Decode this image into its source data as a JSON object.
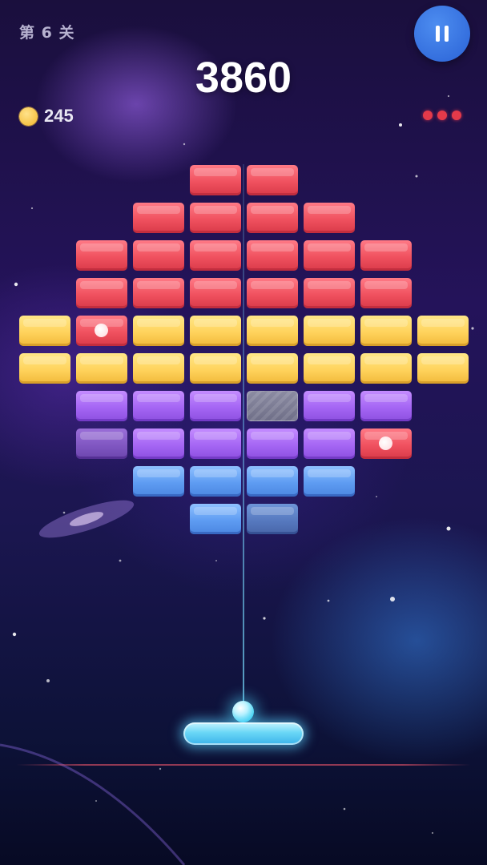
{
  "hud": {
    "level_label": "第 6 关",
    "score": "3860",
    "coins": "245",
    "lives": 3
  },
  "icons": {
    "pause": "pause-icon",
    "coin": "coin-icon",
    "life": "heart-dot-icon"
  },
  "colors": {
    "red": "#f0515f",
    "yellow": "#ffd35c",
    "purple": "#a566f4",
    "blue": "#5e9cf2",
    "steel": "#7a7a92",
    "paddle": "#6ad7f6",
    "pause_button": "#2f6fe0"
  },
  "bricks": [
    {
      "row": 0,
      "col": 3,
      "type": "red"
    },
    {
      "row": 0,
      "col": 4,
      "type": "red"
    },
    {
      "row": 1,
      "col": 2,
      "type": "red"
    },
    {
      "row": 1,
      "col": 3,
      "type": "red"
    },
    {
      "row": 1,
      "col": 4,
      "type": "red"
    },
    {
      "row": 1,
      "col": 5,
      "type": "red"
    },
    {
      "row": 2,
      "col": 1,
      "type": "red"
    },
    {
      "row": 2,
      "col": 2,
      "type": "red"
    },
    {
      "row": 2,
      "col": 3,
      "type": "red"
    },
    {
      "row": 2,
      "col": 4,
      "type": "red"
    },
    {
      "row": 2,
      "col": 5,
      "type": "red"
    },
    {
      "row": 2,
      "col": 6,
      "type": "red"
    },
    {
      "row": 3,
      "col": 1,
      "type": "red"
    },
    {
      "row": 3,
      "col": 2,
      "type": "red"
    },
    {
      "row": 3,
      "col": 3,
      "type": "red"
    },
    {
      "row": 3,
      "col": 4,
      "type": "red"
    },
    {
      "row": 3,
      "col": 5,
      "type": "red"
    },
    {
      "row": 3,
      "col": 6,
      "type": "red"
    },
    {
      "row": 4,
      "col": 0,
      "type": "yellow"
    },
    {
      "row": 4,
      "col": 1,
      "type": "red",
      "powerup": true
    },
    {
      "row": 4,
      "col": 2,
      "type": "yellow"
    },
    {
      "row": 4,
      "col": 3,
      "type": "yellow"
    },
    {
      "row": 4,
      "col": 4,
      "type": "yellow"
    },
    {
      "row": 4,
      "col": 5,
      "type": "yellow"
    },
    {
      "row": 4,
      "col": 6,
      "type": "yellow"
    },
    {
      "row": 4,
      "col": 7,
      "type": "yellow"
    },
    {
      "row": 5,
      "col": 0,
      "type": "yellow"
    },
    {
      "row": 5,
      "col": 1,
      "type": "yellow"
    },
    {
      "row": 5,
      "col": 2,
      "type": "yellow"
    },
    {
      "row": 5,
      "col": 3,
      "type": "yellow"
    },
    {
      "row": 5,
      "col": 4,
      "type": "yellow"
    },
    {
      "row": 5,
      "col": 5,
      "type": "yellow"
    },
    {
      "row": 5,
      "col": 6,
      "type": "yellow"
    },
    {
      "row": 5,
      "col": 7,
      "type": "yellow"
    },
    {
      "row": 6,
      "col": 1,
      "type": "purple"
    },
    {
      "row": 6,
      "col": 2,
      "type": "purple"
    },
    {
      "row": 6,
      "col": 3,
      "type": "purple"
    },
    {
      "row": 6,
      "col": 4,
      "type": "steel"
    },
    {
      "row": 6,
      "col": 5,
      "type": "purple"
    },
    {
      "row": 6,
      "col": 6,
      "type": "purple"
    },
    {
      "row": 7,
      "col": 1,
      "type": "purple-dim"
    },
    {
      "row": 7,
      "col": 2,
      "type": "purple"
    },
    {
      "row": 7,
      "col": 3,
      "type": "purple"
    },
    {
      "row": 7,
      "col": 4,
      "type": "purple"
    },
    {
      "row": 7,
      "col": 5,
      "type": "purple"
    },
    {
      "row": 7,
      "col": 6,
      "type": "red",
      "powerup": true
    },
    {
      "row": 8,
      "col": 2,
      "type": "blue"
    },
    {
      "row": 8,
      "col": 3,
      "type": "blue"
    },
    {
      "row": 8,
      "col": 4,
      "type": "blue"
    },
    {
      "row": 8,
      "col": 5,
      "type": "blue"
    },
    {
      "row": 9,
      "col": 3,
      "type": "blue"
    },
    {
      "row": 9,
      "col": 4,
      "type": "blue-dim"
    }
  ]
}
